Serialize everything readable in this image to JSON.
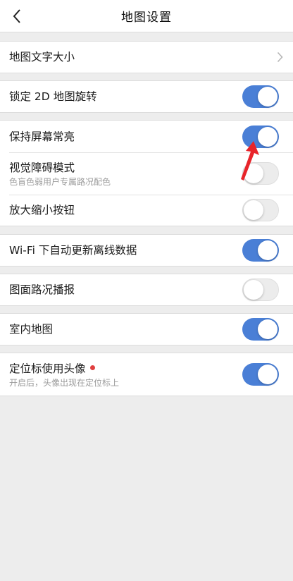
{
  "header": {
    "title": "地图设置"
  },
  "rows": {
    "text_size": {
      "label": "地图文字大小"
    },
    "lock_2d": {
      "label": "锁定 2D 地图旋转",
      "on": true
    },
    "keep_screen": {
      "label": "保持屏幕常亮",
      "on": true
    },
    "visual_mode": {
      "label": "视觉障碍模式",
      "sub": "色盲色弱用户专属路况配色",
      "on": false
    },
    "zoom_buttons": {
      "label": "放大缩小按钮",
      "on": false
    },
    "wifi_update": {
      "label": "Wi-Fi 下自动更新离线数据",
      "on": true
    },
    "traffic_report": {
      "label": "图面路况播报",
      "on": false
    },
    "indoor_map": {
      "label": "室内地图",
      "on": true
    },
    "avatar_marker": {
      "label": "定位标使用头像",
      "sub": "开启后，头像出现在定位标上",
      "on": true
    }
  },
  "colors": {
    "toggle_on": "#4a7fd6",
    "annotation_arrow": "#e8242a",
    "new_dot": "#e04040"
  }
}
